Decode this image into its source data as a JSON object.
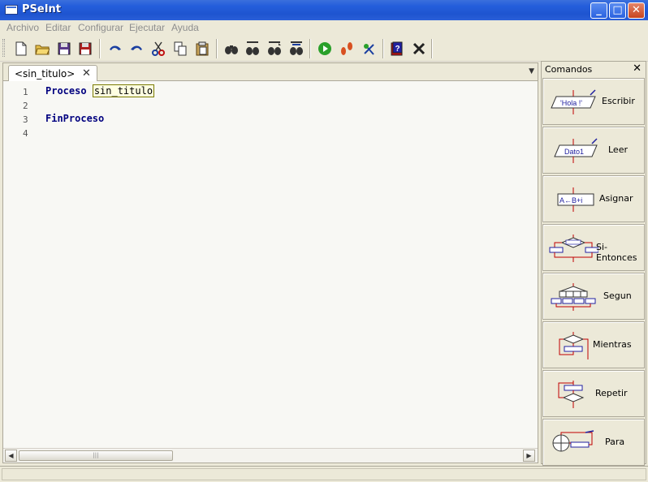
{
  "window": {
    "title": "PSeInt"
  },
  "titlebar": {
    "minimize": "_",
    "maximize": "□",
    "close": "✕"
  },
  "menu": [
    "Archivo",
    "Editar",
    "Configurar",
    "Ejecutar",
    "Ayuda"
  ],
  "toolbar_icons": [
    "new-file-icon",
    "open-file-icon",
    "save-icon",
    "save-as-icon",
    "undo-icon",
    "redo-icon",
    "cut-icon",
    "copy-icon",
    "paste-icon",
    "find-icon",
    "find-previous-icon",
    "find-next-icon",
    "replace-icon",
    "run-icon",
    "step-by-step-icon",
    "debug-icon",
    "help-icon",
    "close-icon"
  ],
  "editor": {
    "tab_label": "<sin_titulo>",
    "tab_close": "✕",
    "dropdown": "▼",
    "lines": [
      {
        "num": "1",
        "keyword": "Proceso",
        "rest": "sin_titulo"
      },
      {
        "num": "2",
        "keyword": "",
        "rest": ""
      },
      {
        "num": "3",
        "keyword": "FinProceso",
        "rest": ""
      },
      {
        "num": "4",
        "keyword": "",
        "rest": ""
      }
    ],
    "scroll_left": "◀",
    "scroll_right": "▶",
    "scroll_grip": "|||"
  },
  "commands": {
    "title": "Comandos",
    "close": "✕",
    "items": [
      {
        "label": "Escribir",
        "icon_text": "'Hola !'"
      },
      {
        "label": "Leer",
        "icon_text": "Dato1"
      },
      {
        "label": "Asignar",
        "icon_text": "A←B+i"
      },
      {
        "label": "Si-Entonces",
        "icon_text": ""
      },
      {
        "label": "Segun",
        "icon_text": ""
      },
      {
        "label": "Mientras",
        "icon_text": ""
      },
      {
        "label": "Repetir",
        "icon_text": ""
      },
      {
        "label": "Para",
        "icon_text": ""
      }
    ]
  },
  "colors": {
    "titlebar": "#245edb",
    "keyword": "#00007f",
    "flow_red": "#c00000",
    "flow_blue": "#2020a0"
  }
}
